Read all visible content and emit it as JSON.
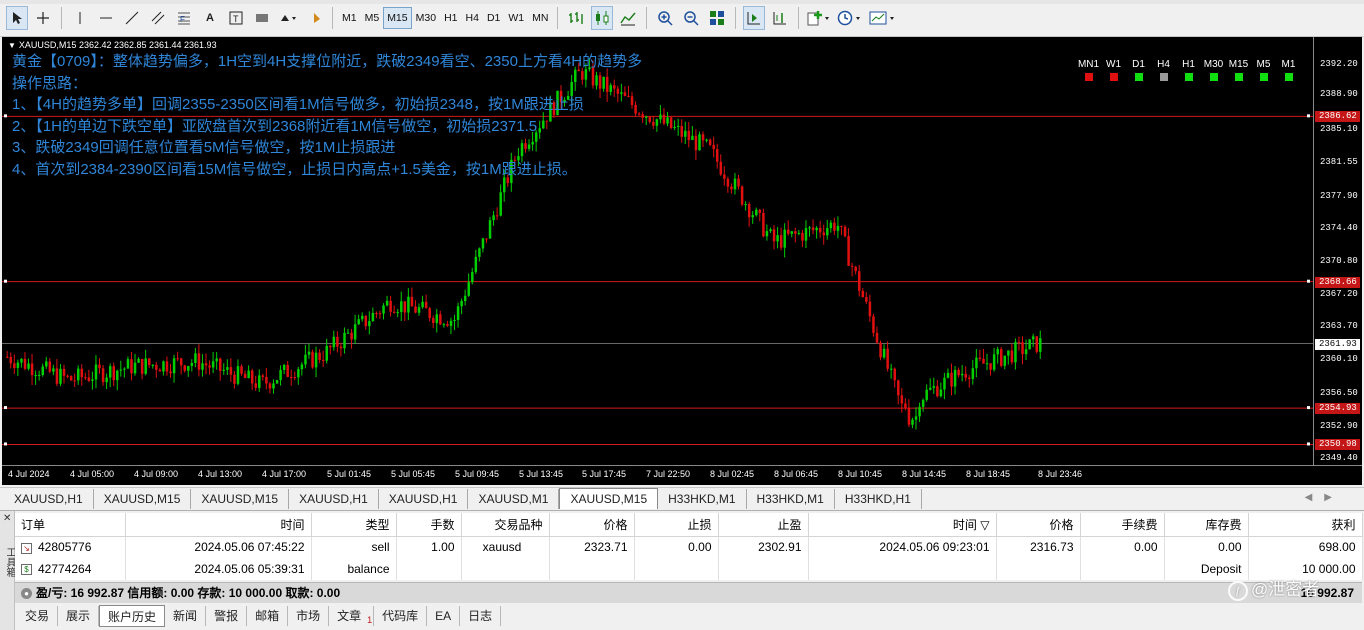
{
  "toolbar": {
    "timeframes": [
      "M1",
      "M5",
      "M15",
      "M30",
      "H1",
      "H4",
      "D1",
      "W1",
      "MN"
    ],
    "active_timeframe": "M15"
  },
  "chart": {
    "header": "XAUUSD,M15  2362.42 2362.85 2361.44 2361.93",
    "note_lines": [
      "黄金【0709】：整体趋势偏多，1H空到4H支撑位附近，跌破2349看空、2350上方看4H的趋势多",
      "操作思路：",
      "1、【4H的趋势多单】回调2355-2350区间看1M信号做多，初始损2348，按1M跟进止损",
      "2、【1H的单边下跌空单】亚欧盘首次到2368附近看1M信号做空，初始损2371.5",
      "3、跌破2349回调任意位置看5M信号做空，按1M止损跟进",
      "4、首次到2384-2390区间看15M信号做空，止损日内高点+1.5美金，按1M跟进止损。"
    ],
    "tf_indicator": [
      {
        "label": "MN1",
        "color": "#e01010"
      },
      {
        "label": "W1",
        "color": "#e01010"
      },
      {
        "label": "D1",
        "color": "#10e010"
      },
      {
        "label": "H4",
        "color": "#9a9a9a"
      },
      {
        "label": "H1",
        "color": "#10e010"
      },
      {
        "label": "M30",
        "color": "#10e010"
      },
      {
        "label": "M15",
        "color": "#10e010"
      },
      {
        "label": "M5",
        "color": "#10e010"
      },
      {
        "label": "M1",
        "color": "#10e010"
      }
    ],
    "price_labels": [
      "2392.20",
      "2388.90",
      "2385.10",
      "2381.55",
      "2377.90",
      "2374.40",
      "2370.80",
      "2367.20",
      "2363.70",
      "2360.10",
      "2356.50",
      "2352.90",
      "2349.40"
    ],
    "levels": [
      {
        "price": 2386.62,
        "label": "2386.62"
      },
      {
        "price": 2368.66,
        "label": "2368.66"
      },
      {
        "price": 2354.93,
        "label": "2354.93"
      },
      {
        "price": 2350.98,
        "label": "2350.98"
      }
    ],
    "current_price": "2361.93",
    "time_labels": [
      "4 Jul 2024",
      "4 Jul 05:00",
      "4 Jul 09:00",
      "4 Jul 13:00",
      "4 Jul 17:00",
      "5 Jul 01:45",
      "5 Jul 05:45",
      "5 Jul 09:45",
      "5 Jul 13:45",
      "5 Jul 17:45",
      "7 Jul 22:50",
      "8 Jul 02:45",
      "8 Jul 06:45",
      "8 Jul 10:45",
      "8 Jul 14:45",
      "8 Jul 18:45",
      "8 Jul 23:46"
    ],
    "bull_color": "#00d000",
    "bear_color": "#e01010",
    "level_color": "#d21a1a"
  },
  "chart_tabs": [
    "XAUUSD,H1",
    "XAUUSD,M15",
    "XAUUSD,M15",
    "XAUUSD,H1",
    "XAUUSD,H1",
    "XAUUSD,M1",
    "XAUUSD,M15",
    "H33HKD,M1",
    "H33HKD,M1",
    "H33HKD,H1"
  ],
  "active_chart_tab": 6,
  "terminal": {
    "columns": [
      "订单",
      "时间",
      "类型",
      "手数",
      "交易品种",
      "价格",
      "止损",
      "止盈",
      "时间",
      "价格",
      "手续费",
      "库存费",
      "获利"
    ],
    "rows": [
      {
        "order": "42805776",
        "time": "2024.05.06 07:45:22",
        "type": "sell",
        "lots": "1.00",
        "symbol": "xauusd",
        "price": "2323.71",
        "sl": "0.00",
        "tp": "2302.91",
        "close_time": "2024.05.06 09:23:01",
        "close_price": "2316.73",
        "commission": "0.00",
        "swap": "0.00",
        "profit": "698.00"
      },
      {
        "order": "42774264",
        "time": "2024.05.06 05:39:31",
        "type": "balance",
        "lots": "",
        "symbol": "",
        "price": "",
        "sl": "",
        "tp": "",
        "close_time": "",
        "close_price": "",
        "commission": "",
        "swap": "Deposit",
        "profit": "10 000.00"
      }
    ],
    "summary": "盈/亏: 16 992.87  信用额: 0.00  存款: 10 000.00  取款: 0.00",
    "summary_right": "16 992.87",
    "side_label": "工具箱",
    "bottom_tabs": [
      "交易",
      "展示",
      "账户历史",
      "新闻",
      "警报",
      "邮箱",
      "市场",
      "文章",
      "代码库",
      "EA",
      "日志"
    ],
    "active_bottom_tab": 2,
    "article_badge": "1"
  },
  "watermark": "@泄密者",
  "chart_data": {
    "type": "candlestick",
    "title": "XAUUSD,M15",
    "ylim": [
      2349.4,
      2393.5
    ],
    "x_range": [
      "4 Jul 2024",
      "8 Jul 23:46"
    ],
    "approx_path": [
      {
        "t": "4 Jul 2024",
        "price": 2360.5
      },
      {
        "t": "4 Jul 05:00",
        "price": 2358.0
      },
      {
        "t": "4 Jul 09:00",
        "price": 2359.5
      },
      {
        "t": "4 Jul 13:00",
        "price": 2360.0
      },
      {
        "t": "4 Jul 17:00",
        "price": 2357.5
      },
      {
        "t": "5 Jul 01:45",
        "price": 2361.0
      },
      {
        "t": "5 Jul 05:45",
        "price": 2366.5
      },
      {
        "t": "5 Jul 09:45",
        "price": 2364.5
      },
      {
        "t": "5 Jul 13:45",
        "price": 2383.0
      },
      {
        "t": "5 Jul 17:45",
        "price": 2391.5
      },
      {
        "t": "7 Jul 22:50",
        "price": 2387.0
      },
      {
        "t": "8 Jul 02:45",
        "price": 2383.0
      },
      {
        "t": "8 Jul 06:45",
        "price": 2373.0
      },
      {
        "t": "8 Jul 10:45",
        "price": 2375.0
      },
      {
        "t": "8 Jul 14:45",
        "price": 2355.0
      },
      {
        "t": "8 Jul 18:45",
        "price": 2359.0
      },
      {
        "t": "8 Jul 23:46",
        "price": 2361.93
      }
    ],
    "horizontal_levels": [
      2386.62,
      2368.66,
      2354.93,
      2350.98
    ],
    "last_price": 2361.93
  }
}
